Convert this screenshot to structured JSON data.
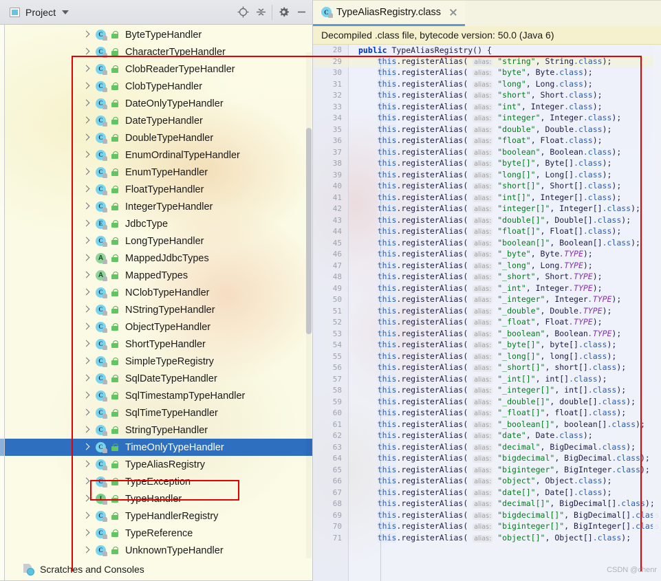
{
  "panel": {
    "title": "Project",
    "icon": "project-icon",
    "dropdown_icon": "chevron-down-icon",
    "toolbar": [
      {
        "name": "locate-icon",
        "label": ""
      },
      {
        "name": "collapse-all-icon",
        "label": ""
      },
      {
        "name": "gear-icon",
        "label": ""
      },
      {
        "name": "minimize-icon",
        "label": ""
      }
    ],
    "footer": {
      "label": "Scratches and Consoles",
      "icon": "scratches-icon"
    }
  },
  "tree": {
    "selected_index": 24,
    "items": [
      {
        "kind": "C",
        "label": "ByteTypeHandler"
      },
      {
        "kind": "C",
        "label": "CharacterTypeHandler"
      },
      {
        "kind": "C",
        "label": "ClobReaderTypeHandler"
      },
      {
        "kind": "C",
        "label": "ClobTypeHandler"
      },
      {
        "kind": "C",
        "label": "DateOnlyTypeHandler"
      },
      {
        "kind": "C",
        "label": "DateTypeHandler"
      },
      {
        "kind": "C",
        "label": "DoubleTypeHandler"
      },
      {
        "kind": "C",
        "label": "EnumOrdinalTypeHandler"
      },
      {
        "kind": "C",
        "label": "EnumTypeHandler"
      },
      {
        "kind": "C",
        "label": "FloatTypeHandler"
      },
      {
        "kind": "C",
        "label": "IntegerTypeHandler"
      },
      {
        "kind": "E",
        "label": "JdbcType"
      },
      {
        "kind": "C",
        "label": "LongTypeHandler"
      },
      {
        "kind": "A",
        "label": "MappedJdbcTypes"
      },
      {
        "kind": "A",
        "label": "MappedTypes"
      },
      {
        "kind": "C",
        "label": "NClobTypeHandler"
      },
      {
        "kind": "C",
        "label": "NStringTypeHandler"
      },
      {
        "kind": "C",
        "label": "ObjectTypeHandler"
      },
      {
        "kind": "C",
        "label": "ShortTypeHandler"
      },
      {
        "kind": "C",
        "label": "SimpleTypeRegistry"
      },
      {
        "kind": "C",
        "label": "SqlDateTypeHandler"
      },
      {
        "kind": "C",
        "label": "SqlTimestampTypeHandler"
      },
      {
        "kind": "C",
        "label": "SqlTimeTypeHandler"
      },
      {
        "kind": "C",
        "label": "StringTypeHandler"
      },
      {
        "kind": "C",
        "label": "TimeOnlyTypeHandler"
      },
      {
        "kind": "C",
        "label": "TypeAliasRegistry"
      },
      {
        "kind": "C",
        "label": "TypeException"
      },
      {
        "kind": "I",
        "label": "TypeHandler"
      },
      {
        "kind": "C",
        "label": "TypeHandlerRegistry"
      },
      {
        "kind": "C",
        "label": "TypeReference"
      },
      {
        "kind": "C",
        "label": "UnknownTypeHandler"
      }
    ]
  },
  "editor": {
    "tab": {
      "label": "TypeAliasRegistry.class",
      "kind": "C",
      "close_icon": "close-icon"
    },
    "notice": "Decompiled .class file, bytecode version: 50.0 (Java 6)",
    "hint_label": "alias:",
    "first_line_number": 28,
    "caret_line_number": 29,
    "header_line": {
      "number": 28,
      "keyword": "public",
      "signature": " TypeAliasRegistry() {"
    },
    "lines": [
      {
        "n": 29,
        "alias": "\"string\"",
        "value": "String",
        "suffix": ".class"
      },
      {
        "n": 30,
        "alias": "\"byte\"",
        "value": "Byte",
        "suffix": ".class"
      },
      {
        "n": 31,
        "alias": "\"long\"",
        "value": "Long",
        "suffix": ".class"
      },
      {
        "n": 32,
        "alias": "\"short\"",
        "value": "Short",
        "suffix": ".class"
      },
      {
        "n": 33,
        "alias": "\"int\"",
        "value": "Integer",
        "suffix": ".class"
      },
      {
        "n": 34,
        "alias": "\"integer\"",
        "value": "Integer",
        "suffix": ".class"
      },
      {
        "n": 35,
        "alias": "\"double\"",
        "value": "Double",
        "suffix": ".class"
      },
      {
        "n": 36,
        "alias": "\"float\"",
        "value": "Float",
        "suffix": ".class"
      },
      {
        "n": 37,
        "alias": "\"boolean\"",
        "value": "Boolean",
        "suffix": ".class"
      },
      {
        "n": 38,
        "alias": "\"byte[]\"",
        "value": "Byte[]",
        "suffix": ".class"
      },
      {
        "n": 39,
        "alias": "\"long[]\"",
        "value": "Long[]",
        "suffix": ".class"
      },
      {
        "n": 40,
        "alias": "\"short[]\"",
        "value": "Short[]",
        "suffix": ".class"
      },
      {
        "n": 41,
        "alias": "\"int[]\"",
        "value": "Integer[]",
        "suffix": ".class"
      },
      {
        "n": 42,
        "alias": "\"integer[]\"",
        "value": "Integer[]",
        "suffix": ".class"
      },
      {
        "n": 43,
        "alias": "\"double[]\"",
        "value": "Double[]",
        "suffix": ".class"
      },
      {
        "n": 44,
        "alias": "\"float[]\"",
        "value": "Float[]",
        "suffix": ".class"
      },
      {
        "n": 45,
        "alias": "\"boolean[]\"",
        "value": "Boolean[]",
        "suffix": ".class"
      },
      {
        "n": 46,
        "alias": "\"_byte\"",
        "value": "Byte",
        "suffix": ".TYPE"
      },
      {
        "n": 47,
        "alias": "\"_long\"",
        "value": "Long",
        "suffix": ".TYPE"
      },
      {
        "n": 48,
        "alias": "\"_short\"",
        "value": "Short",
        "suffix": ".TYPE"
      },
      {
        "n": 49,
        "alias": "\"_int\"",
        "value": "Integer",
        "suffix": ".TYPE"
      },
      {
        "n": 50,
        "alias": "\"_integer\"",
        "value": "Integer",
        "suffix": ".TYPE"
      },
      {
        "n": 51,
        "alias": "\"_double\"",
        "value": "Double",
        "suffix": ".TYPE"
      },
      {
        "n": 52,
        "alias": "\"_float\"",
        "value": "Float",
        "suffix": ".TYPE"
      },
      {
        "n": 53,
        "alias": "\"_boolean\"",
        "value": "Boolean",
        "suffix": ".TYPE"
      },
      {
        "n": 54,
        "alias": "\"_byte[]\"",
        "value": "byte[]",
        "suffix": ".class"
      },
      {
        "n": 55,
        "alias": "\"_long[]\"",
        "value": "long[]",
        "suffix": ".class"
      },
      {
        "n": 56,
        "alias": "\"_short[]\"",
        "value": "short[]",
        "suffix": ".class"
      },
      {
        "n": 57,
        "alias": "\"_int[]\"",
        "value": "int[]",
        "suffix": ".class"
      },
      {
        "n": 58,
        "alias": "\"_integer[]\"",
        "value": "int[]",
        "suffix": ".class"
      },
      {
        "n": 59,
        "alias": "\"_double[]\"",
        "value": "double[]",
        "suffix": ".class"
      },
      {
        "n": 60,
        "alias": "\"_float[]\"",
        "value": "float[]",
        "suffix": ".class"
      },
      {
        "n": 61,
        "alias": "\"_boolean[]\"",
        "value": "boolean[]",
        "suffix": ".class"
      },
      {
        "n": 62,
        "alias": "\"date\"",
        "value": "Date",
        "suffix": ".class"
      },
      {
        "n": 63,
        "alias": "\"decimal\"",
        "value": "BigDecimal",
        "suffix": ".class"
      },
      {
        "n": 64,
        "alias": "\"bigdecimal\"",
        "value": "BigDecimal",
        "suffix": ".class"
      },
      {
        "n": 65,
        "alias": "\"biginteger\"",
        "value": "BigInteger",
        "suffix": ".class"
      },
      {
        "n": 66,
        "alias": "\"object\"",
        "value": "Object",
        "suffix": ".class"
      },
      {
        "n": 67,
        "alias": "\"date[]\"",
        "value": "Date[]",
        "suffix": ".class"
      },
      {
        "n": 68,
        "alias": "\"decimal[]\"",
        "value": "BigDecimal[]",
        "suffix": ".class"
      },
      {
        "n": 69,
        "alias": "\"bigdecimal[]\"",
        "value": "BigDecimal[]",
        "suffix": ".class"
      },
      {
        "n": 70,
        "alias": "\"biginteger[]\"",
        "value": "BigInteger[]",
        "suffix": ".class"
      },
      {
        "n": 71,
        "alias": "\"object[]\"",
        "value": "Object[]",
        "suffix": ".class"
      }
    ],
    "call_prefix": "this",
    "call_method": ".registerAlias(",
    "call_tail": ");"
  },
  "watermark": "CSDN @chenr",
  "colors": {
    "selection_blue": "#2f6fc0",
    "annotation_red": "#e60000",
    "string_green": "#017d1b",
    "keyword_blue": "#0033b3",
    "type_purple": "#8a2fb8",
    "tab_underline": "#5a9ad6"
  }
}
